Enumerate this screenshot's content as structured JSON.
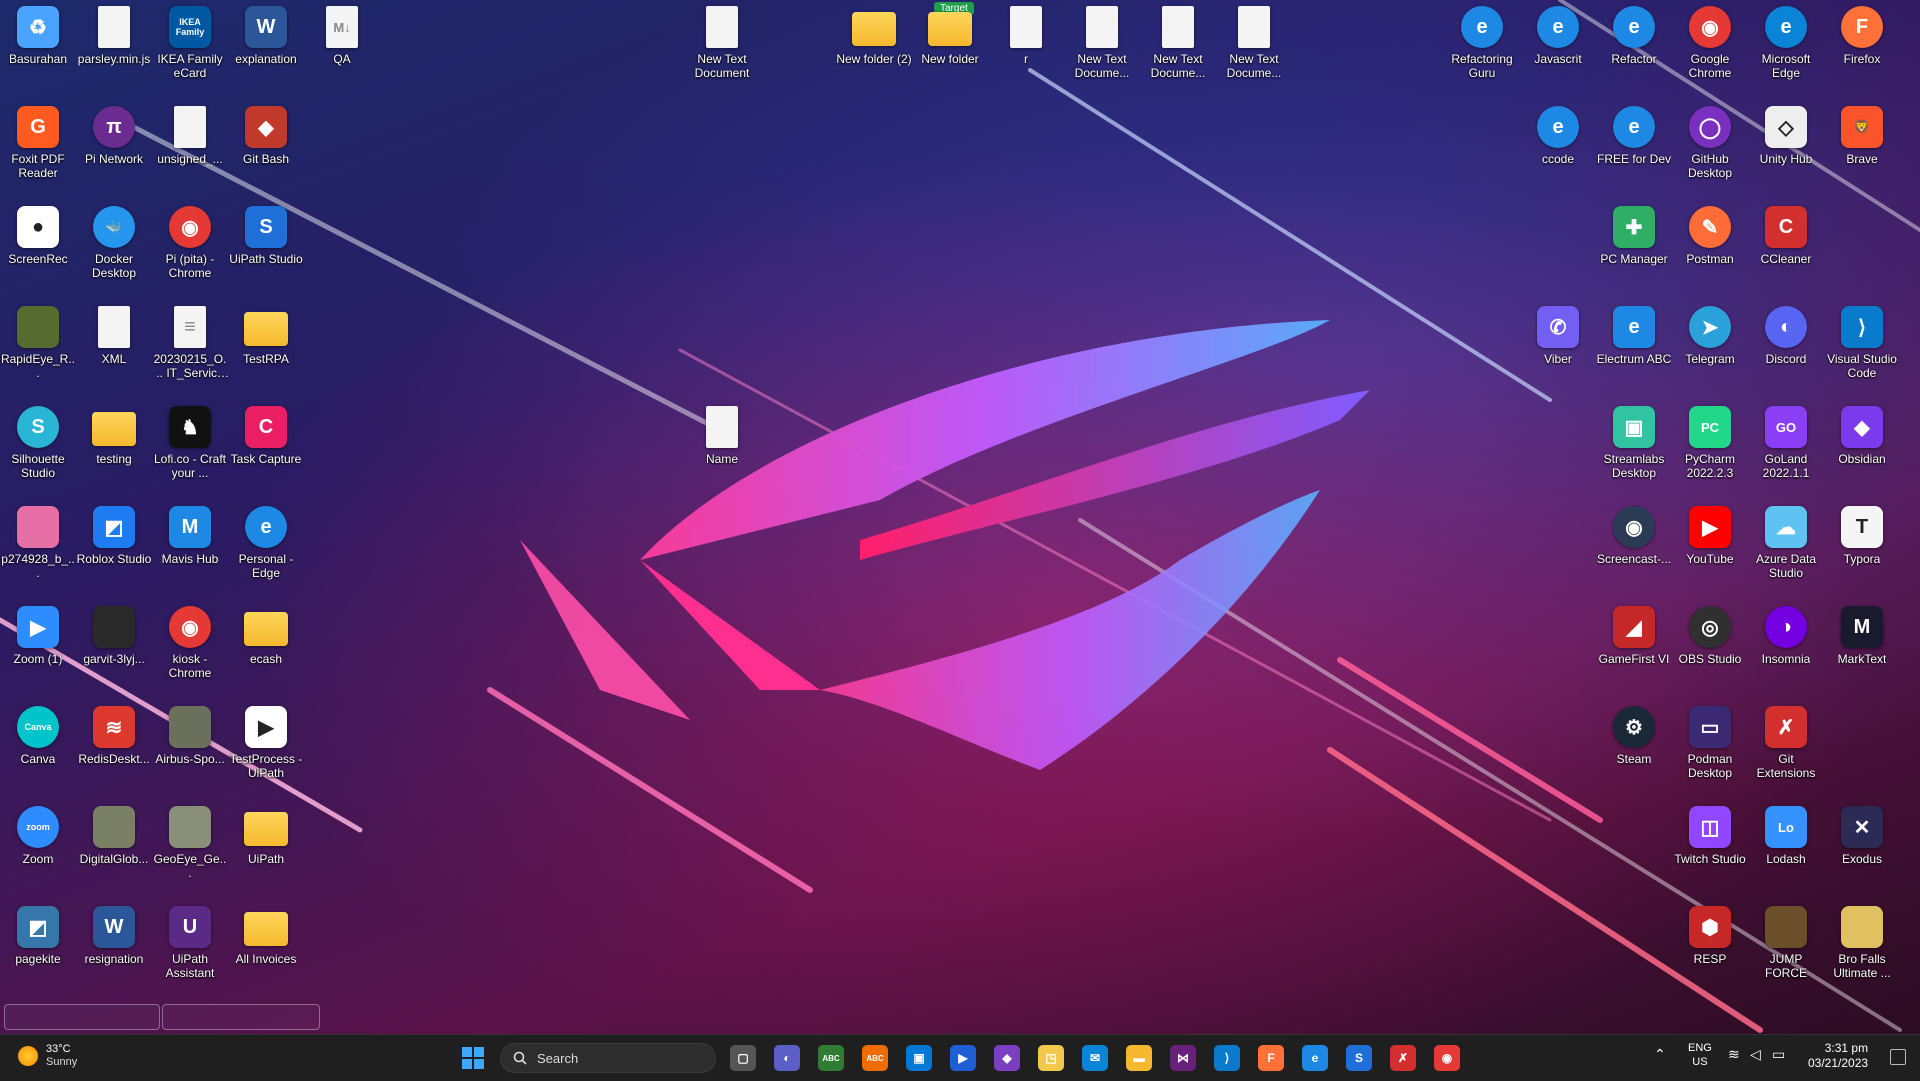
{
  "desktop": {
    "badge": "Target",
    "icons": [
      {
        "label": "Basurahan",
        "color": "#4aa3ff",
        "kind": "app",
        "glyph": "♻"
      },
      {
        "label": "parsley.min.js",
        "kind": "doc",
        "glyph": ""
      },
      {
        "label": "IKEA Family eCard",
        "color": "#0058a3",
        "kind": "app",
        "glyph": "IKEA Family"
      },
      {
        "label": "explanation",
        "color": "#2b579a",
        "kind": "app",
        "glyph": "W"
      },
      {
        "label": "QA",
        "kind": "doc",
        "glyph": "M↓"
      },
      {
        "label": "New Text Document",
        "kind": "doc",
        "glyph": ""
      },
      {
        "label": "New folder (2)",
        "kind": "folder",
        "glyph": ""
      },
      {
        "label": "New folder",
        "kind": "folder",
        "glyph": ""
      },
      {
        "label": "r",
        "kind": "doc",
        "glyph": ""
      },
      {
        "label": "New Text Docume...",
        "kind": "doc",
        "glyph": ""
      },
      {
        "label": "New Text Docume...",
        "kind": "doc",
        "glyph": ""
      },
      {
        "label": "New Text Docume...",
        "kind": "doc",
        "glyph": ""
      },
      {
        "label": "Refactoring Guru",
        "color": "#1e88e5",
        "kind": "round",
        "glyph": "e"
      },
      {
        "label": "Javascrit",
        "color": "#1e88e5",
        "kind": "round",
        "glyph": "e"
      },
      {
        "label": "Refactor",
        "color": "#1e88e5",
        "kind": "round",
        "glyph": "e"
      },
      {
        "label": "Google Chrome",
        "color": "#e53935",
        "kind": "round",
        "glyph": "◉"
      },
      {
        "label": "Microsoft Edge",
        "color": "#0a84d6",
        "kind": "round",
        "glyph": "e"
      },
      {
        "label": "Firefox",
        "color": "#ff7139",
        "kind": "round",
        "glyph": "F"
      },
      {
        "label": "Foxit PDF Reader",
        "color": "#ff5a1f",
        "kind": "app",
        "glyph": "G"
      },
      {
        "label": "Pi Network",
        "color": "#6b2c91",
        "kind": "round",
        "glyph": "π"
      },
      {
        "label": "unsigned_...",
        "kind": "doc",
        "glyph": ""
      },
      {
        "label": "Git Bash",
        "color": "#c0392b",
        "kind": "app",
        "glyph": "◆"
      },
      {
        "label": "ccode",
        "color": "#1e88e5",
        "kind": "round",
        "glyph": "e"
      },
      {
        "label": "FREE for Dev",
        "color": "#1e88e5",
        "kind": "round",
        "glyph": "e"
      },
      {
        "label": "GitHub Desktop",
        "color": "#7b2fbf",
        "kind": "round",
        "glyph": "◯"
      },
      {
        "label": "Unity Hub",
        "color": "#eeeeee",
        "kind": "app",
        "glyph": "◇"
      },
      {
        "label": "Brave",
        "color": "#fb542b",
        "kind": "app",
        "glyph": "🦁"
      },
      {
        "label": "ScreenRec",
        "color": "#ffffff",
        "kind": "app",
        "glyph": "●"
      },
      {
        "label": "Docker Desktop",
        "color": "#2496ed",
        "kind": "round",
        "glyph": "🐳"
      },
      {
        "label": "Pi (pita) - Chrome",
        "color": "#e53935",
        "kind": "round",
        "glyph": "◉"
      },
      {
        "label": "UiPath Studio",
        "color": "#1f6fd8",
        "kind": "app",
        "glyph": "S"
      },
      {
        "label": "PC Manager",
        "color": "#2fae66",
        "kind": "app",
        "glyph": "✚"
      },
      {
        "label": "Postman",
        "color": "#ff6c37",
        "kind": "round",
        "glyph": "✎"
      },
      {
        "label": "CCleaner",
        "color": "#d32f2f",
        "kind": "app",
        "glyph": "C"
      },
      {
        "label": "RapidEye_R...",
        "color": "#556b2f",
        "kind": "app",
        "glyph": ""
      },
      {
        "label": "XML",
        "kind": "doc",
        "glyph": ""
      },
      {
        "label": "20230215_O... IT_Service A...",
        "kind": "doc",
        "glyph": "≡"
      },
      {
        "label": "TestRPA",
        "kind": "folder",
        "glyph": ""
      },
      {
        "label": "Viber",
        "color": "#7360f2",
        "kind": "app",
        "glyph": "✆"
      },
      {
        "label": "Electrum ABC",
        "color": "#1e88e5",
        "kind": "app",
        "glyph": "e"
      },
      {
        "label": "Telegram",
        "color": "#2aa1da",
        "kind": "round",
        "glyph": "➤"
      },
      {
        "label": "Discord",
        "color": "#5865f2",
        "kind": "round",
        "glyph": "◐"
      },
      {
        "label": "Visual Studio Code",
        "color": "#0a7acc",
        "kind": "app",
        "glyph": "⟩"
      },
      {
        "label": "Silhouette Studio",
        "color": "#29b6d6",
        "kind": "round",
        "glyph": "S"
      },
      {
        "label": "testing",
        "kind": "folder",
        "glyph": ""
      },
      {
        "label": "Lofi.co - Craft your ...",
        "color": "#111111",
        "kind": "app",
        "glyph": "♞"
      },
      {
        "label": "Task Capture",
        "color": "#e91e63",
        "kind": "app",
        "glyph": "C"
      },
      {
        "label": "Streamlabs Desktop",
        "color": "#31c3a2",
        "kind": "app",
        "glyph": "▣"
      },
      {
        "label": "PyCharm 2022.2.3",
        "color": "#21d789",
        "kind": "app",
        "glyph": "PC"
      },
      {
        "label": "GoLand 2022.1.1",
        "color": "#8a3ff6",
        "kind": "app",
        "glyph": "GO"
      },
      {
        "label": "Obsidian",
        "color": "#7c3aed",
        "kind": "app",
        "glyph": "◆"
      },
      {
        "label": "p274928_b_...",
        "color": "#e66fa6",
        "kind": "app",
        "glyph": ""
      },
      {
        "label": "Roblox Studio",
        "color": "#1d7cf2",
        "kind": "app",
        "glyph": "◩"
      },
      {
        "label": "Mavis Hub",
        "color": "#1e88e5",
        "kind": "app",
        "glyph": "M"
      },
      {
        "label": "Personal - Edge",
        "color": "#1e88e5",
        "kind": "round",
        "glyph": "e"
      },
      {
        "label": "Screencast-...",
        "color": "#2b3a55",
        "kind": "round",
        "glyph": "◉"
      },
      {
        "label": "YouTube",
        "color": "#ff0000",
        "kind": "app",
        "glyph": "▶"
      },
      {
        "label": "Azure Data Studio",
        "color": "#5ec2f2",
        "kind": "app",
        "glyph": "☁"
      },
      {
        "label": "Typora",
        "color": "#f5f5f5",
        "kind": "app",
        "glyph": "T"
      },
      {
        "label": "Zoom (1)",
        "color": "#2d8cff",
        "kind": "app",
        "glyph": "▶"
      },
      {
        "label": "garvit-3lyj...",
        "color": "#2a2a2a",
        "kind": "app",
        "glyph": ""
      },
      {
        "label": "kiosk - Chrome",
        "color": "#e53935",
        "kind": "round",
        "glyph": "◉"
      },
      {
        "label": "ecash",
        "kind": "folder",
        "glyph": ""
      },
      {
        "label": "GameFirst VI",
        "color": "#c62828",
        "kind": "app",
        "glyph": "◢"
      },
      {
        "label": "OBS Studio",
        "color": "#303030",
        "kind": "round",
        "glyph": "◎"
      },
      {
        "label": "Insomnia",
        "color": "#7400e1",
        "kind": "round",
        "glyph": "◑"
      },
      {
        "label": "MarkText",
        "color": "#1a1a2e",
        "kind": "app",
        "glyph": "M"
      },
      {
        "label": "Canva",
        "color": "#00c4cc",
        "kind": "round",
        "glyph": "Canva"
      },
      {
        "label": "RedisDeskt...",
        "color": "#dc382d",
        "kind": "app",
        "glyph": "≋"
      },
      {
        "label": "Airbus-Spo...",
        "color": "#6b705c",
        "kind": "app",
        "glyph": ""
      },
      {
        "label": "TestProcess - UiPath",
        "color": "#ffffff",
        "kind": "app",
        "glyph": "▶"
      },
      {
        "label": "Steam",
        "color": "#1b2838",
        "kind": "round",
        "glyph": "⚙"
      },
      {
        "label": "Podman Desktop",
        "color": "#3b2a73",
        "kind": "app",
        "glyph": "▭"
      },
      {
        "label": "Git Extensions",
        "color": "#d32f2f",
        "kind": "app",
        "glyph": "✗"
      },
      {
        "label": "Zoom",
        "color": "#2d8cff",
        "kind": "round",
        "glyph": "zoom"
      },
      {
        "label": "DigitalGlob...",
        "color": "#7a8066",
        "kind": "app",
        "glyph": ""
      },
      {
        "label": "GeoEye_Ge...",
        "color": "#8a8f7a",
        "kind": "app",
        "glyph": ""
      },
      {
        "label": "UiPath",
        "kind": "folder",
        "glyph": ""
      },
      {
        "label": "Twitch Studio",
        "color": "#9146ff",
        "kind": "app",
        "glyph": "◫"
      },
      {
        "label": "Lodash",
        "color": "#3492ff",
        "kind": "app",
        "glyph": "Lo"
      },
      {
        "label": "Exodus",
        "color": "#2b2b55",
        "kind": "app",
        "glyph": "✕"
      },
      {
        "label": "pagekite",
        "color": "#3776ab",
        "kind": "app",
        "glyph": "◩"
      },
      {
        "label": "resignation",
        "color": "#2b579a",
        "kind": "app",
        "glyph": "W"
      },
      {
        "label": "UiPath Assistant",
        "color": "#5b2a86",
        "kind": "app",
        "glyph": "U"
      },
      {
        "label": "All Invoices",
        "kind": "folder",
        "glyph": ""
      },
      {
        "label": "RESP",
        "color": "#c62828",
        "kind": "app",
        "glyph": "⬢"
      },
      {
        "label": "JUMP FORCE",
        "color": "#6b4f2a",
        "kind": "app",
        "glyph": ""
      },
      {
        "label": "Bro Falls Ultimate ...",
        "color": "#e0c060",
        "kind": "app",
        "glyph": ""
      },
      {
        "label": "Name",
        "kind": "doc",
        "glyph": ""
      }
    ]
  },
  "taskbar": {
    "weather": {
      "temp": "33°C",
      "cond": "Sunny"
    },
    "search_label": "Search",
    "apps": [
      {
        "name": "task-view",
        "color": "#555",
        "glyph": "▢"
      },
      {
        "name": "teams-chat",
        "color": "#5b5fc7",
        "glyph": "◐"
      },
      {
        "name": "abc-app-1",
        "color": "#2e7d32",
        "glyph": "ABC"
      },
      {
        "name": "abc-app-2",
        "color": "#ef6c00",
        "glyph": "ABC"
      },
      {
        "name": "microsoft-store",
        "color": "#0078d4",
        "glyph": "▣"
      },
      {
        "name": "power-automate",
        "color": "#1e5fd6",
        "glyph": "▶"
      },
      {
        "name": "visual-studio",
        "color": "#7b3fbf",
        "glyph": "◆"
      },
      {
        "name": "sticky-notes",
        "color": "#f2c94c",
        "glyph": "◳"
      },
      {
        "name": "mail",
        "color": "#0a84d6",
        "glyph": "✉"
      },
      {
        "name": "file-explorer",
        "color": "#f5b82e",
        "glyph": "▬"
      },
      {
        "name": "visual-studio-2",
        "color": "#68217a",
        "glyph": "⋈"
      },
      {
        "name": "vs-code",
        "color": "#0a7acc",
        "glyph": "⟩"
      },
      {
        "name": "firefox",
        "color": "#ff7139",
        "glyph": "F"
      },
      {
        "name": "edge",
        "color": "#1e88e5",
        "glyph": "e"
      },
      {
        "name": "uipath",
        "color": "#1f6fd8",
        "glyph": "S"
      },
      {
        "name": "git-extensions",
        "color": "#d32f2f",
        "glyph": "✗"
      },
      {
        "name": "chrome",
        "color": "#e53935",
        "glyph": "◉"
      }
    ],
    "lang": "ENG",
    "region": "US",
    "time": "3:31 pm",
    "date": "03/21/2023"
  }
}
